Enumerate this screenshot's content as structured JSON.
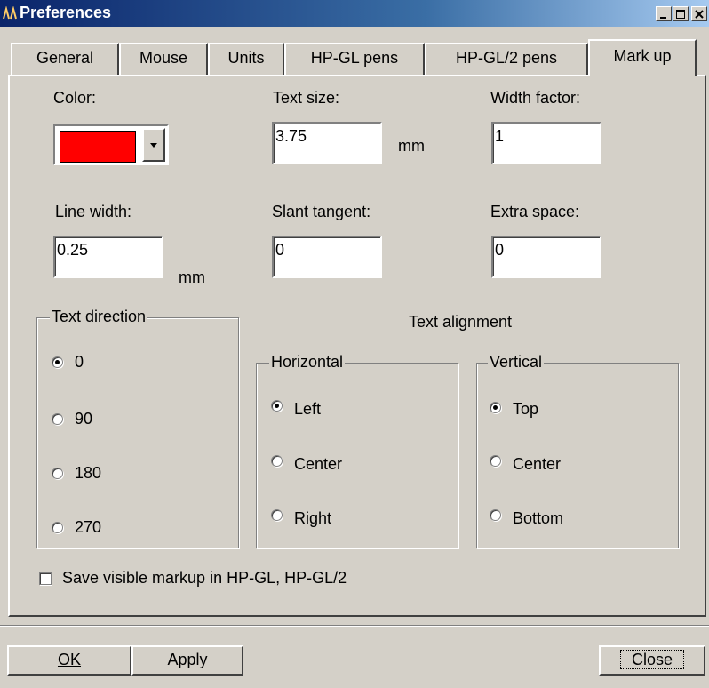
{
  "window": {
    "title": "Preferences"
  },
  "tabs": [
    "General",
    "Mouse",
    "Units",
    "HP-GL pens",
    "HP-GL/2 pens",
    "Mark up"
  ],
  "fields": {
    "color_label": "Color:",
    "color_value": "#ff0000",
    "text_size_label": "Text size:",
    "text_size_value": "3.75",
    "text_size_unit": "mm",
    "width_factor_label": "Width factor:",
    "width_factor_value": "1",
    "line_width_label": "Line width:",
    "line_width_value": "0.25",
    "line_width_unit": "mm",
    "slant_tangent_label": "Slant tangent:",
    "slant_tangent_value": "0",
    "extra_space_label": "Extra space:",
    "extra_space_value": "0"
  },
  "text_direction": {
    "title": "Text direction",
    "options": [
      "0",
      "90",
      "180",
      "270"
    ],
    "selected": "0"
  },
  "text_alignment": {
    "title": "Text alignment",
    "horizontal": {
      "title": "Horizontal",
      "options": [
        "Left",
        "Center",
        "Right"
      ],
      "selected": "Left"
    },
    "vertical": {
      "title": "Vertical",
      "options": [
        "Top",
        "Center",
        "Bottom"
      ],
      "selected": "Top"
    }
  },
  "save_markup": {
    "label": "Save visible markup in HP-GL, HP-GL/2",
    "checked": false
  },
  "buttons": {
    "ok": "OK",
    "apply": "Apply",
    "close": "Close"
  }
}
